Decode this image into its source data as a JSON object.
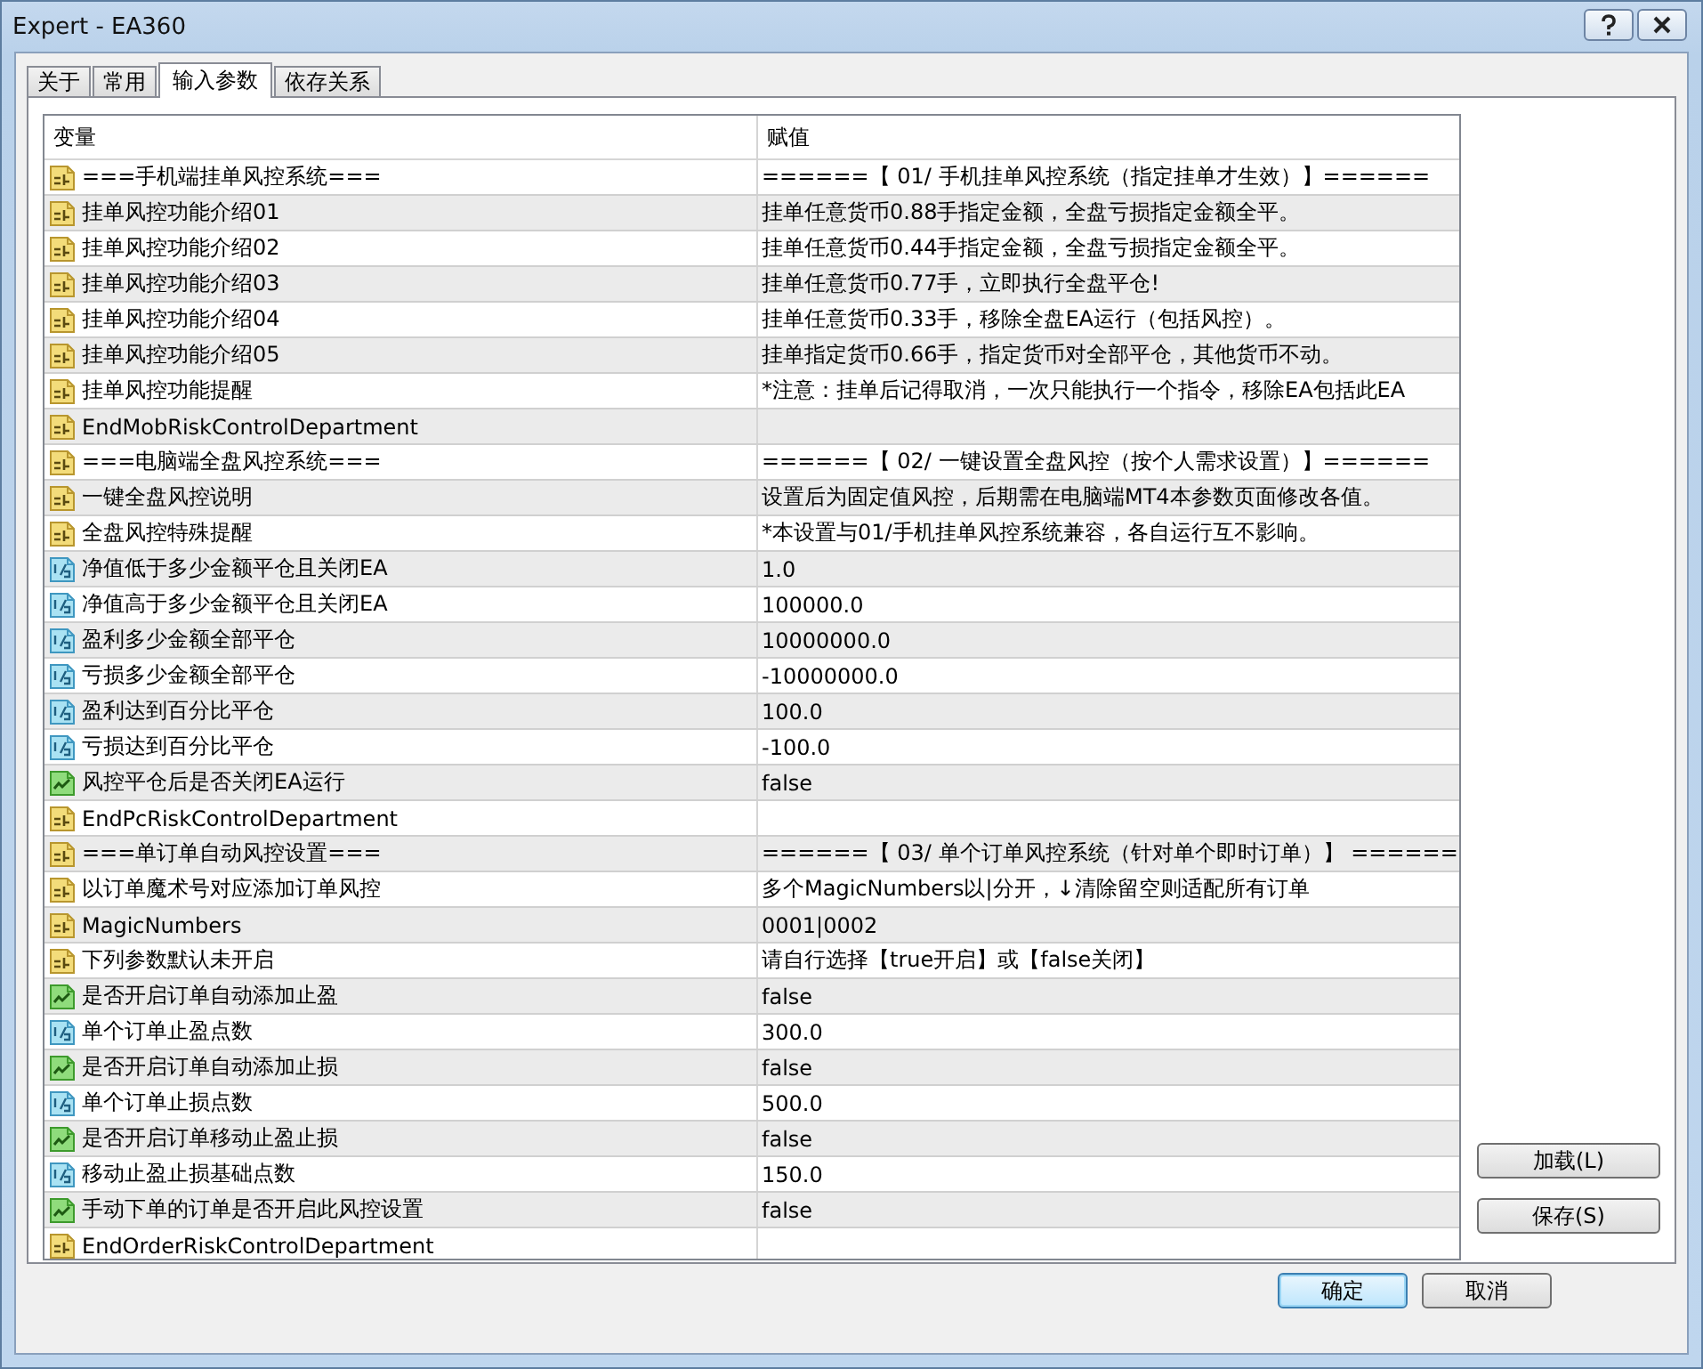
{
  "window": {
    "title": "Expert - EA360"
  },
  "tabs": [
    {
      "label": "关于",
      "selected": false
    },
    {
      "label": "常用",
      "selected": false
    },
    {
      "label": "输入参数",
      "selected": true
    },
    {
      "label": "依存关系",
      "selected": false
    }
  ],
  "table": {
    "columns": [
      "变量",
      "赋值"
    ],
    "rows": [
      {
        "kind": "string",
        "name": "===手机端挂单风控系统===",
        "value": "======【 01/ 手机挂单风控系统（指定挂单才生效）】======"
      },
      {
        "kind": "string",
        "name": "挂单风控功能介绍01",
        "value": "挂单任意货币0.88手指定金额，全盘亏损指定金额全平。"
      },
      {
        "kind": "string",
        "name": "挂单风控功能介绍02",
        "value": "挂单任意货币0.44手指定金额，全盘亏损指定金额全平。"
      },
      {
        "kind": "string",
        "name": "挂单风控功能介绍03",
        "value": "挂单任意货币0.77手，立即执行全盘平仓!"
      },
      {
        "kind": "string",
        "name": "挂单风控功能介绍04",
        "value": "挂单任意货币0.33手，移除全盘EA运行（包括风控）。"
      },
      {
        "kind": "string",
        "name": "挂单风控功能介绍05",
        "value": "挂单指定货币0.66手，指定货币对全部平仓，其他货币不动。"
      },
      {
        "kind": "string",
        "name": "挂单风控功能提醒",
        "value": "*注意：挂单后记得取消，一次只能执行一个指令，移除EA包括此EA"
      },
      {
        "kind": "string",
        "name": "EndMobRiskControlDepartment"
      },
      {
        "kind": "string",
        "name": "===电脑端全盘风控系统===",
        "value": "======【 02/ 一键设置全盘风控（按个人需求设置）】======"
      },
      {
        "kind": "string",
        "name": "一键全盘风控说明",
        "value": "设置后为固定值风控，后期需在电脑端MT4本参数页面修改各值。"
      },
      {
        "kind": "string",
        "name": "全盘风控特殊提醒",
        "value": "*本设置与01/手机挂单风控系统兼容，各自运行互不影响。"
      },
      {
        "kind": "double",
        "name": "净值低于多少金额平仓且关闭EA",
        "value": "1.0"
      },
      {
        "kind": "double",
        "name": "净值高于多少金额平仓且关闭EA",
        "value": "100000.0"
      },
      {
        "kind": "double",
        "name": "盈利多少金额全部平仓",
        "value": "10000000.0"
      },
      {
        "kind": "double",
        "name": "亏损多少金额全部平仓",
        "value": "-10000000.0"
      },
      {
        "kind": "double",
        "name": "盈利达到百分比平仓",
        "value": "100.0"
      },
      {
        "kind": "double",
        "name": "亏损达到百分比平仓",
        "value": "-100.0"
      },
      {
        "kind": "bool",
        "name": "风控平仓后是否关闭EA运行",
        "value": "false"
      },
      {
        "kind": "string",
        "name": "EndPcRiskControlDepartment"
      },
      {
        "kind": "string",
        "name": "===单订单自动风控设置===",
        "value": "======【 03/ 单个订单风控系统（针对单个即时订单）】 ======"
      },
      {
        "kind": "string",
        "name": "以订单魔术号对应添加订单风控",
        "value": "多个MagicNumbers以|分开，↓清除留空则适配所有订单"
      },
      {
        "kind": "string",
        "name": "MagicNumbers",
        "value": "0001|0002"
      },
      {
        "kind": "string",
        "name": "下列参数默认未开启",
        "value": "请自行选择【true开启】或【false关闭】"
      },
      {
        "kind": "bool",
        "name": "是否开启订单自动添加止盈",
        "value": "false"
      },
      {
        "kind": "double",
        "name": "单个订单止盈点数",
        "value": "300.0"
      },
      {
        "kind": "bool",
        "name": "是否开启订单自动添加止损",
        "value": "false"
      },
      {
        "kind": "double",
        "name": "单个订单止损点数",
        "value": "500.0"
      },
      {
        "kind": "bool",
        "name": "是否开启订单移动止盈止损",
        "value": "false"
      },
      {
        "kind": "double",
        "name": "移动止盈止损基础点数",
        "value": "150.0"
      },
      {
        "kind": "bool",
        "name": "手动下单的订单是否开启此风控设置",
        "value": "false"
      },
      {
        "kind": "string",
        "name": "EndOrderRiskControlDepartment"
      }
    ]
  },
  "side_buttons": [
    "加载(L)",
    "保存(S)"
  ],
  "buttons": [
    {
      "label": "确定",
      "default": true
    },
    {
      "label": "取消",
      "default": false
    }
  ]
}
